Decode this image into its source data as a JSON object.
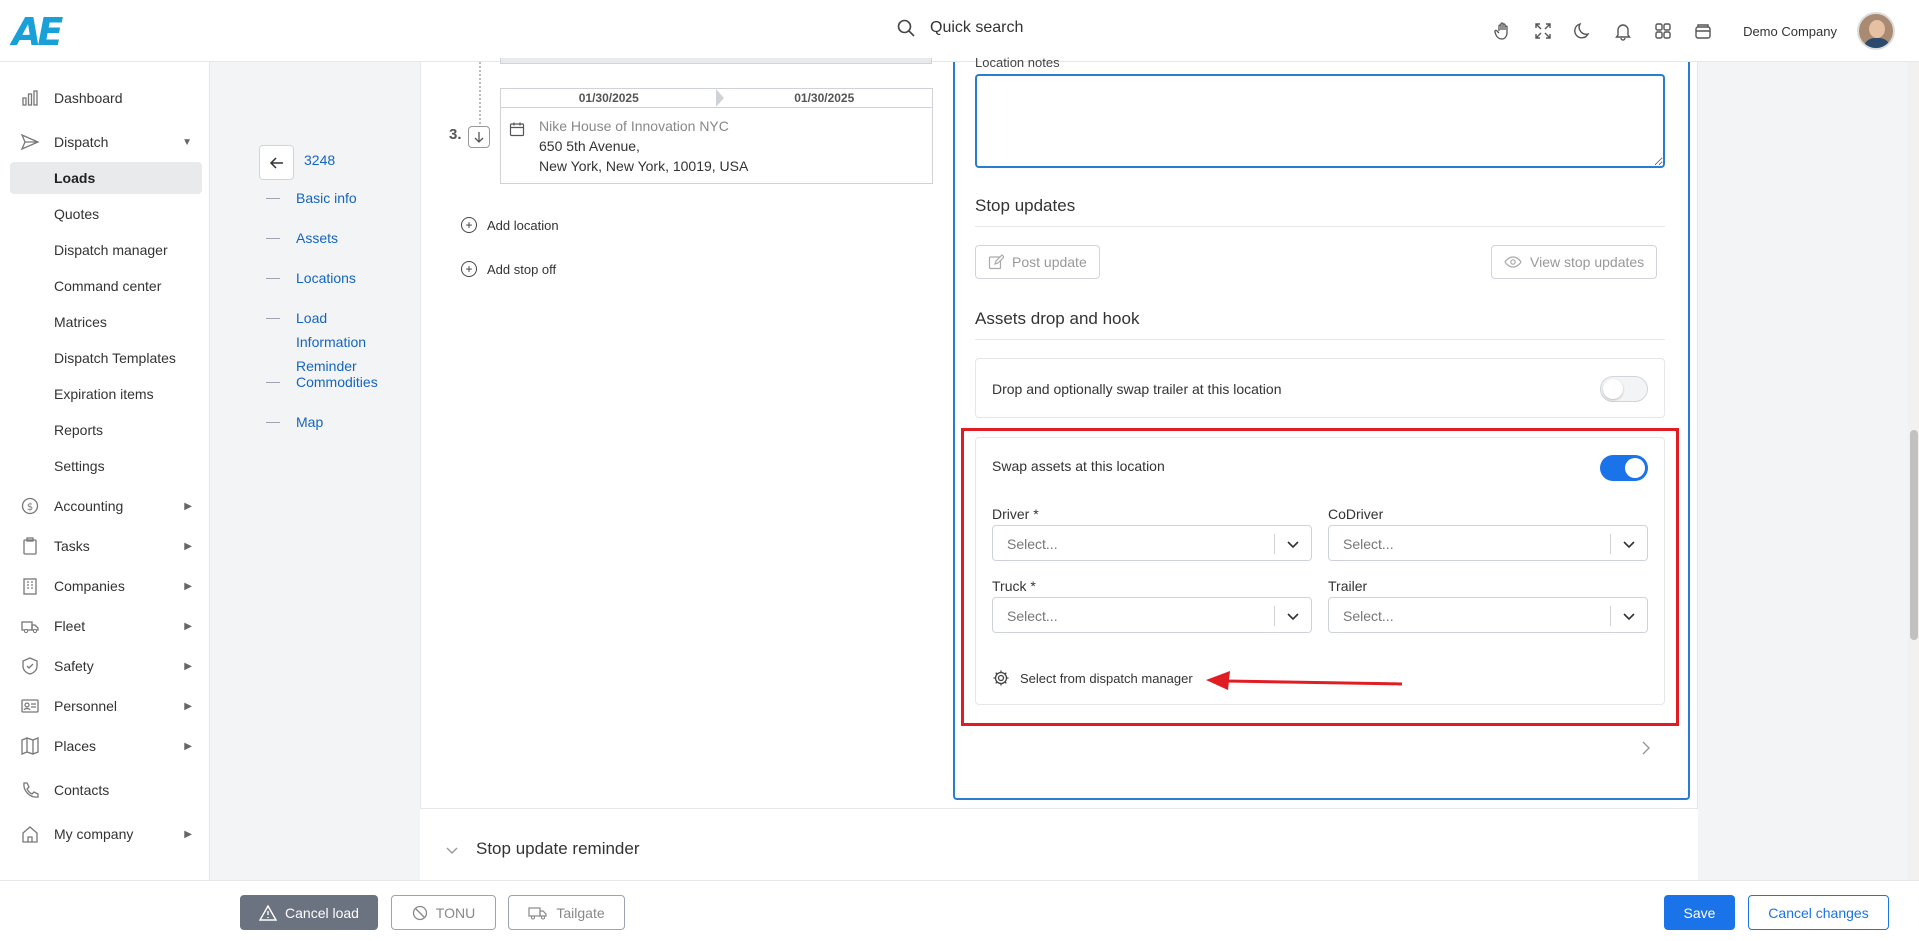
{
  "header": {
    "logo_text": "AE",
    "search_label": "Quick search",
    "company_name": "Demo Company",
    "icons": [
      "hand-icon",
      "fullscreen-icon",
      "moon-icon",
      "bell-icon",
      "apps-grid-icon",
      "wallet-icon"
    ]
  },
  "sidebar": {
    "items": [
      {
        "label": "Dashboard",
        "icon": "chart-bars-icon"
      },
      {
        "label": "Dispatch",
        "icon": "send-icon",
        "expanded": true
      },
      {
        "label": "Accounting",
        "icon": "dollar-circle-icon"
      },
      {
        "label": "Tasks",
        "icon": "clipboard-icon"
      },
      {
        "label": "Companies",
        "icon": "building-icon"
      },
      {
        "label": "Fleet",
        "icon": "truck-icon"
      },
      {
        "label": "Safety",
        "icon": "shield-icon"
      },
      {
        "label": "Personnel",
        "icon": "id-card-icon"
      },
      {
        "label": "Places",
        "icon": "map-icon"
      },
      {
        "label": "Contacts",
        "icon": "phone-icon"
      },
      {
        "label": "My company",
        "icon": "home-icon"
      }
    ],
    "dispatch_sub": [
      "Loads",
      "Quotes",
      "Dispatch manager",
      "Command center",
      "Matrices",
      "Dispatch Templates",
      "Expiration items",
      "Reports",
      "Settings"
    ],
    "active_sub": "Loads"
  },
  "toc": {
    "load_number": "3248",
    "items": [
      "Basic info",
      "Assets",
      "Locations",
      "Load Information Reminder",
      "Commodities",
      "Map"
    ]
  },
  "stop": {
    "number": "3.",
    "date_from": "01/30/2025",
    "date_to": "01/30/2025",
    "name": "Nike House of Innovation NYC",
    "address1": "650 5th Avenue,",
    "address2": "New York, New York, 10019, USA"
  },
  "actions": {
    "add_location": "Add location",
    "add_stop_off": "Add stop off"
  },
  "right": {
    "location_notes_label": "Location notes",
    "location_notes_value": "",
    "stop_updates_title": "Stop updates",
    "post_update": "Post update",
    "view_stop_updates": "View stop updates",
    "assets_title": "Assets drop and hook",
    "drop_swap_label": "Drop and optionally swap trailer at this location",
    "drop_swap_on": false,
    "swap_assets_label": "Swap assets at this location",
    "swap_assets_on": true,
    "driver_label": "Driver *",
    "codriver_label": "CoDriver",
    "truck_label": "Truck *",
    "trailer_label": "Trailer",
    "select_placeholder": "Select...",
    "dispatch_manager_link": "Select from dispatch manager"
  },
  "reminder": {
    "title": "Stop update reminder"
  },
  "footer": {
    "cancel_load": "Cancel load",
    "tonu": "TONU",
    "tailgate": "Tailgate",
    "save": "Save",
    "cancel_changes": "Cancel changes"
  },
  "colors": {
    "accent": "#1a73e8",
    "highlight": "#e11d24",
    "link": "#1565c0"
  }
}
